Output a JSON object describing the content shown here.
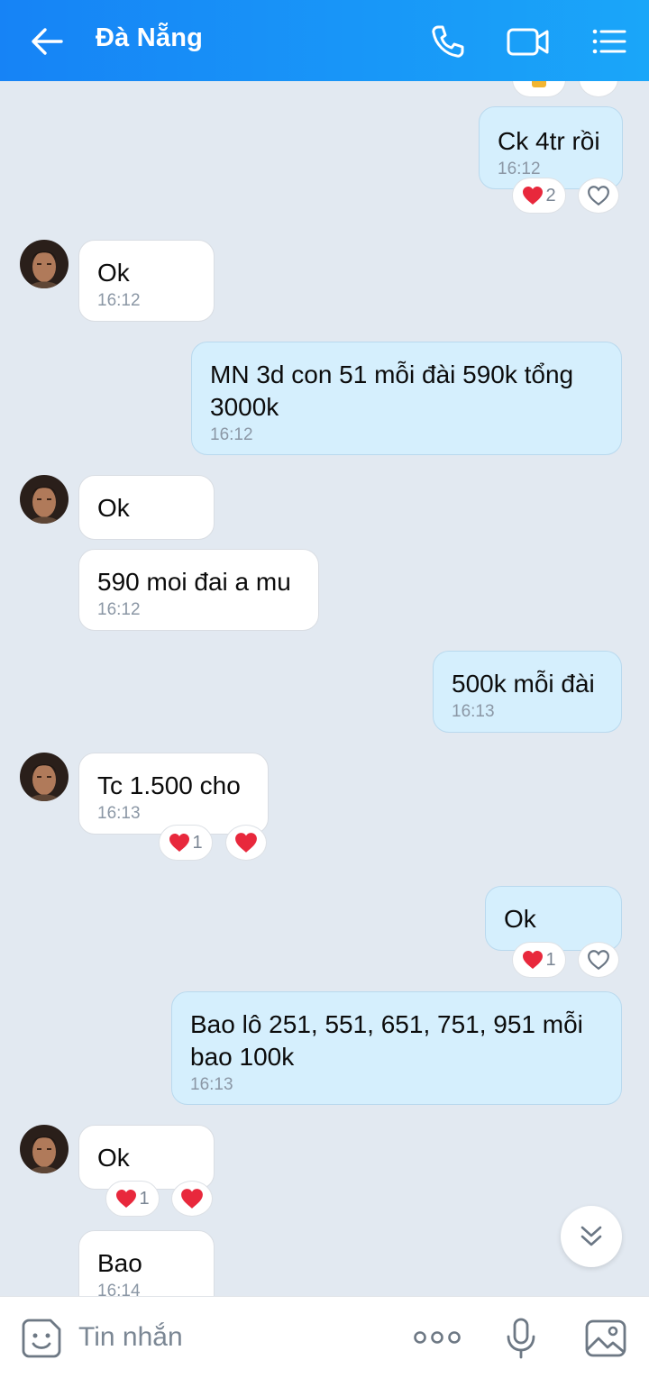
{
  "header": {
    "title": "Đà Nẵng",
    "back_icon": "arrow-left-icon",
    "call_icon": "phone-icon",
    "video_icon": "video-camera-icon",
    "menu_icon": "list-menu-icon",
    "color": "#1a8ff7"
  },
  "messages": [
    {
      "dir": "out",
      "text": "Ck 4tr rồi",
      "time": "16:12",
      "reaction_count": "2"
    },
    {
      "dir": "in",
      "text": "Ok",
      "time": "16:12"
    },
    {
      "dir": "out",
      "text_line1": "MN 3d con 51 mỗi đài 590k tổng",
      "text_line2": "3000k",
      "time": "16:12"
    },
    {
      "dir": "in",
      "text": "Ok"
    },
    {
      "dir": "in",
      "text": "590 moi đai a mu",
      "time": "16:12"
    },
    {
      "dir": "out",
      "text": "500k mỗi đài",
      "time": "16:13"
    },
    {
      "dir": "in",
      "text": "Tc 1.500 cho",
      "time": "16:13",
      "reaction_count": "1"
    },
    {
      "dir": "out",
      "text": "Ok",
      "reaction_count": "1"
    },
    {
      "dir": "out",
      "text_line1": "Bao lô 251, 551, 651, 751, 951 mỗi",
      "text_line2": "bao 100k",
      "time": "16:13"
    },
    {
      "dir": "in",
      "text": "Ok",
      "reaction_count": "1"
    },
    {
      "dir": "in",
      "text": "Bao",
      "time": "16:14"
    }
  ],
  "input": {
    "placeholder": "Tin nhắn",
    "sticker_icon": "sticker-icon",
    "more_icon": "more-dots-icon",
    "mic_icon": "microphone-icon",
    "image_icon": "image-icon"
  },
  "colors": {
    "chat_bg": "#e2e9f1",
    "outgoing_bubble": "#d5effd",
    "incoming_bubble": "#ffffff",
    "heart": "#e8283c"
  }
}
